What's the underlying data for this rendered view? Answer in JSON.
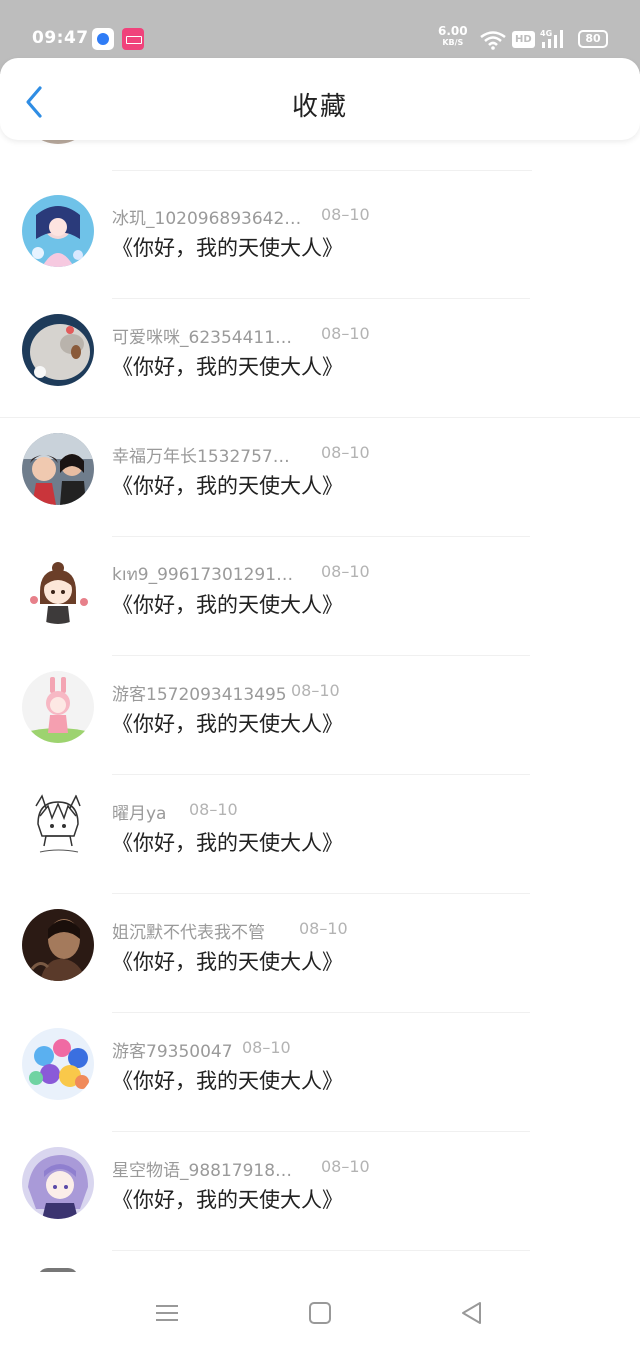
{
  "status_bar": {
    "time": "09:47",
    "net_speed": "6.00",
    "net_unit": "KB/S",
    "hd": "HD",
    "network": "4G",
    "battery": "80"
  },
  "header": {
    "title": "收藏",
    "accent": "#2f8de4"
  },
  "items": [
    {
      "name": "冰玑_102096893642…",
      "date": "08–10",
      "book": "《你好，我的天使大人》"
    },
    {
      "name": "可爱咪咪_62354411…",
      "date": "08–10",
      "book": "《你好，我的天使大人》"
    },
    {
      "name": "幸福万年长1532757…",
      "date": "08–10",
      "book": "《你好，我的天使大人》"
    },
    {
      "name": "kıท9_99617301291…",
      "date": "08–10",
      "book": "《你好，我的天使大人》"
    },
    {
      "name": "游客1572093413495",
      "date": "08–10",
      "book": "《你好，我的天使大人》"
    },
    {
      "name": "曜月ya",
      "date": "08–10",
      "book": "《你好，我的天使大人》"
    },
    {
      "name": "姐沉默不代表我不管",
      "date": "08–10",
      "book": "《你好，我的天使大人》"
    },
    {
      "name": "游客79350047",
      "date": "08–10",
      "book": "《你好，我的天使大人》"
    },
    {
      "name": "星空物语_98817918…",
      "date": "08–10",
      "book": "《你好，我的天使大人》"
    }
  ]
}
